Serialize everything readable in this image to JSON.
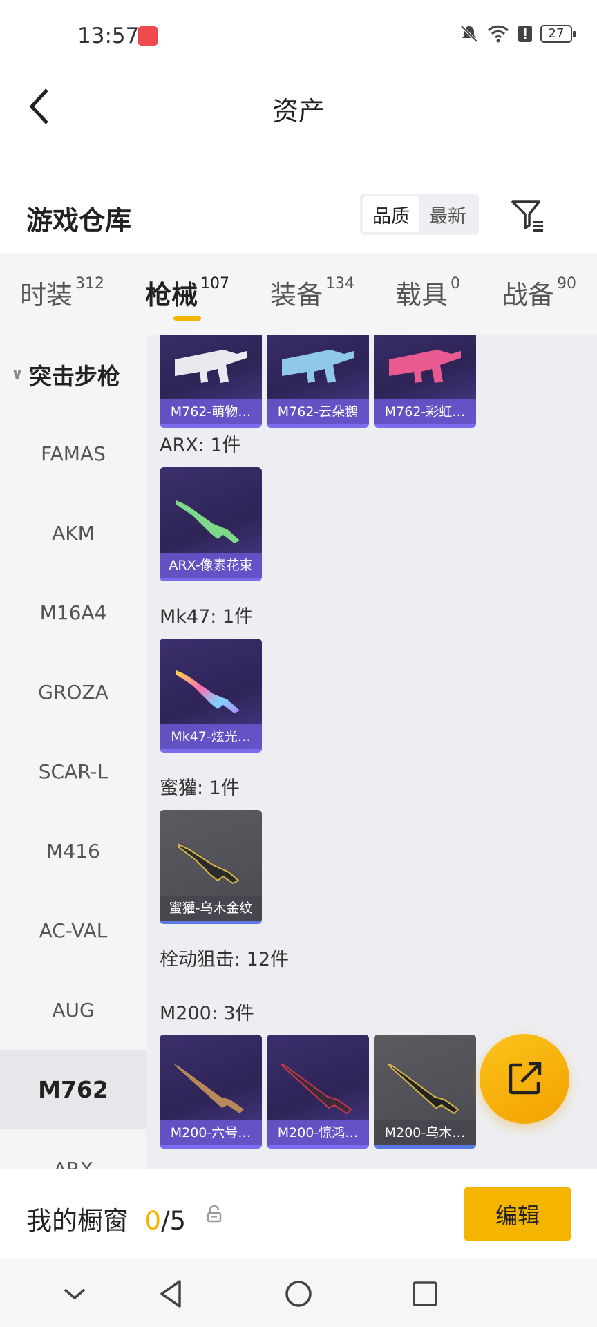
{
  "status": {
    "time": "13:57",
    "battery": "27"
  },
  "header": {
    "title": "资产"
  },
  "section": {
    "title": "游戏仓库",
    "sort_quality": "品质",
    "sort_newest": "最新"
  },
  "tabs": [
    {
      "label": "时装",
      "count": "312"
    },
    {
      "label": "枪械",
      "count": "107"
    },
    {
      "label": "装备",
      "count": "134"
    },
    {
      "label": "载具",
      "count": "0"
    },
    {
      "label": "战备",
      "count": "90"
    }
  ],
  "sidebar": {
    "category": "突击步枪",
    "items": [
      "FAMAS",
      "AKM",
      "M16A4",
      "GROZA",
      "SCAR-L",
      "M416",
      "AC-VAL",
      "AUG",
      "M762",
      "ARX"
    ],
    "active": "M762"
  },
  "content": {
    "row_top": [
      "M762-萌物…",
      "M762-云朵鹅",
      "M762-彩虹…"
    ],
    "arx_label": "ARX: 1件",
    "arx_items": [
      "ARX-像素花束"
    ],
    "mk47_label": "Mk47: 1件",
    "mk47_items": [
      "Mk47-炫光…"
    ],
    "honeybadger_label": "蜜獾: 1件",
    "honeybadger_items": [
      "蜜獾-乌木金纹"
    ],
    "sniper_label": "栓动狙击: 12件",
    "m200_label": "M200: 3件",
    "m200_items": [
      "M200-六号…",
      "M200-惊鸿…",
      "M200-乌木…"
    ]
  },
  "showcase": {
    "label": "我的橱窗",
    "current": "0",
    "total": "/5",
    "edit": "编辑"
  },
  "colors": {
    "accent": "#f5b400",
    "card_purple": "#2e2456",
    "card_gray": "#4a4a50"
  }
}
